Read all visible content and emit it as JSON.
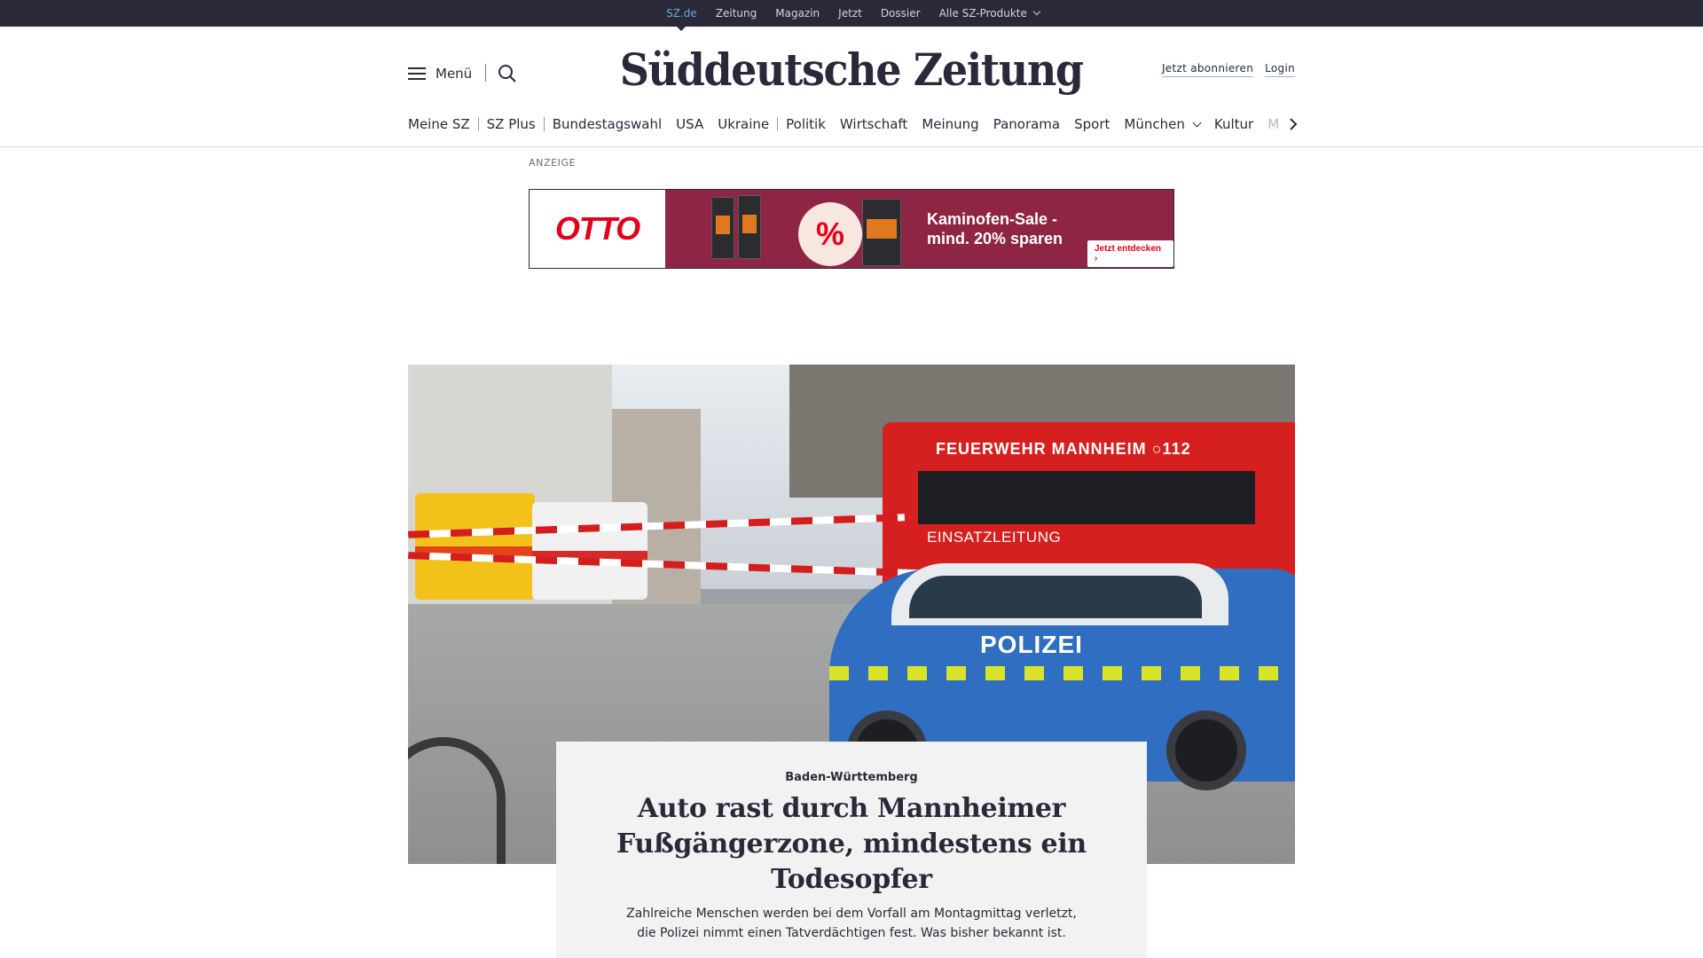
{
  "topbar": {
    "links": [
      "SZ.de",
      "Zeitung",
      "Magazin",
      "Jetzt",
      "Dossier"
    ],
    "products_label": "Alle SZ-Produkte",
    "active_color": "#6ea8d3",
    "bg_color": "#29293a"
  },
  "header": {
    "menu_label": "Menü",
    "logo": "Süddeutsche Zeitung",
    "subscribe_label": "Jetzt abonnieren",
    "login_label": "Login"
  },
  "nav": {
    "items": [
      "Meine SZ",
      "SZ Plus",
      "Bundestagswahl",
      "USA",
      "Ukraine",
      "Politik",
      "Wirtschaft",
      "Meinung",
      "Panorama",
      "Sport",
      "München",
      "Kultur",
      "M"
    ]
  },
  "ad": {
    "label": "ANZEIGE",
    "brand": "OTTO",
    "percent_symbol": "%",
    "headline_line1": "Kaminofen-Sale -",
    "headline_line2": "mind. 20% sparen",
    "cta": "Jetzt entdecken",
    "brand_color": "#e3001b",
    "promo_color": "#8e2545"
  },
  "hero": {
    "vehicle_text_fire": "FEUERWEHR MANNHEIM",
    "vehicle_text_fire_number": "112",
    "vehicle_text_fire_2": "EINSATZLEITUNG",
    "vehicle_text_police": "POLIZEI"
  },
  "article": {
    "kicker": "Baden-Württemberg",
    "headline": "Auto rast durch Mannheimer Fußgängerzone, mindestens ein Todesopfer",
    "teaser": "Zahlreiche Menschen werden bei dem Vorfall am Montagmittag verletzt, die Polizei nimmt einen Tatverdächtigen fest. Was bisher bekannt ist."
  }
}
